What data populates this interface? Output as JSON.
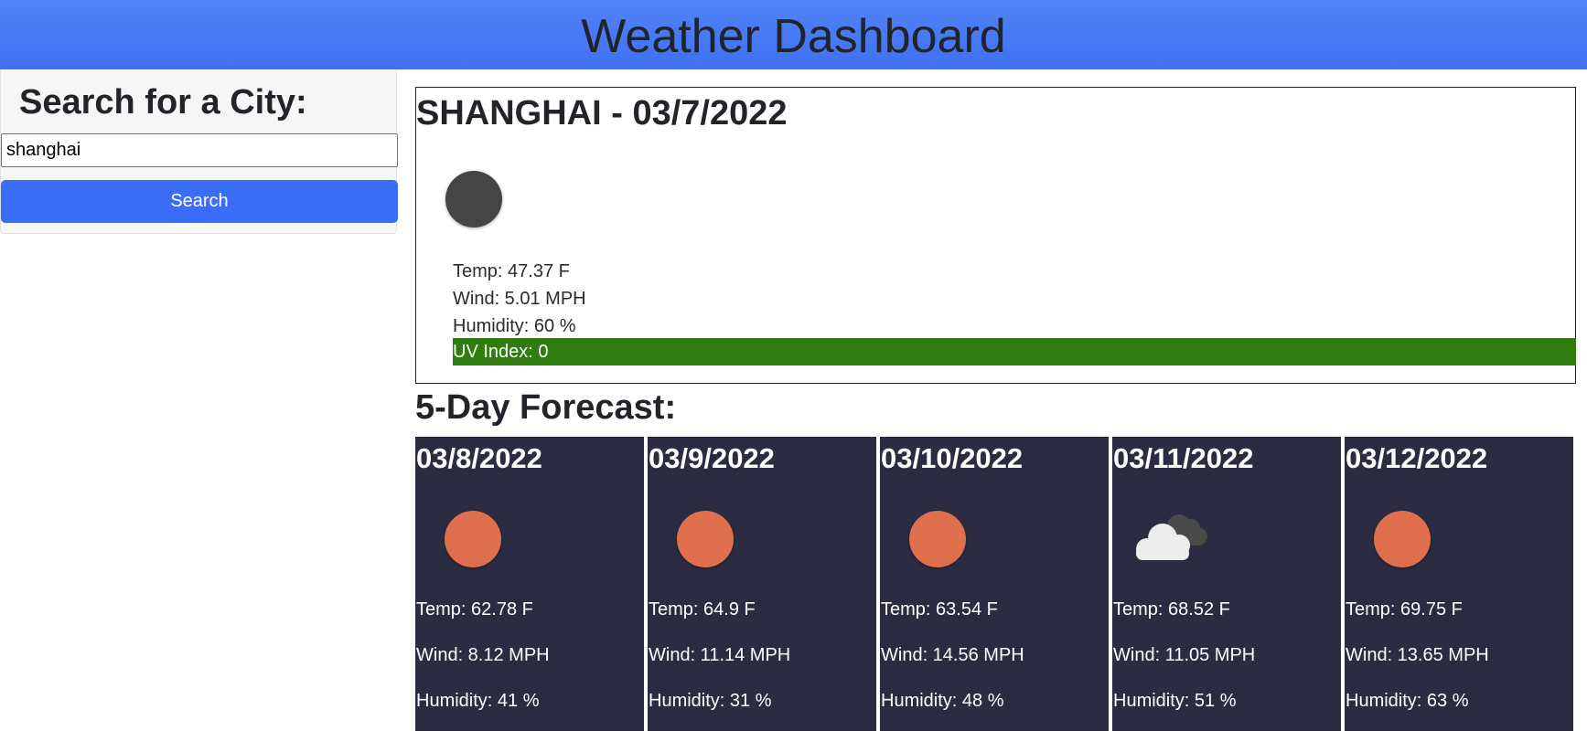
{
  "header": {
    "title": "Weather Dashboard"
  },
  "sidebar": {
    "heading": "Search for a City:",
    "search_value": "shanghai",
    "search_button_label": "Search"
  },
  "current": {
    "title": "SHANGHAI - 03/7/2022",
    "icon": "dark-circle-icon",
    "temp": "Temp: 47.37 F",
    "wind": "Wind: 5.01 MPH",
    "humidity": "Humidity: 60 %",
    "uv": "UV Index: 0",
    "uv_color": "#2e7d0e"
  },
  "forecast": {
    "title": "5-Day Forecast:",
    "days": [
      {
        "date": "03/8/2022",
        "icon": "sun-icon",
        "temp": "Temp: 62.78 F",
        "wind": "Wind: 8.12 MPH",
        "humidity": "Humidity: 41 %"
      },
      {
        "date": "03/9/2022",
        "icon": "sun-icon",
        "temp": "Temp: 64.9 F",
        "wind": "Wind: 11.14 MPH",
        "humidity": "Humidity: 31 %"
      },
      {
        "date": "03/10/2022",
        "icon": "sun-icon",
        "temp": "Temp: 63.54 F",
        "wind": "Wind: 14.56 MPH",
        "humidity": "Humidity: 48 %"
      },
      {
        "date": "03/11/2022",
        "icon": "cloud-icon",
        "temp": "Temp: 68.52 F",
        "wind": "Wind: 11.05 MPH",
        "humidity": "Humidity: 51 %"
      },
      {
        "date": "03/12/2022",
        "icon": "sun-icon",
        "temp": "Temp: 69.75 F",
        "wind": "Wind: 13.65 MPH",
        "humidity": "Humidity: 63 %"
      }
    ]
  },
  "colors": {
    "header": "#4a7cf6",
    "button": "#3b6ef8",
    "card": "#2b2c42",
    "sun": "#e0704d",
    "uv_low": "#2e7d0e"
  }
}
